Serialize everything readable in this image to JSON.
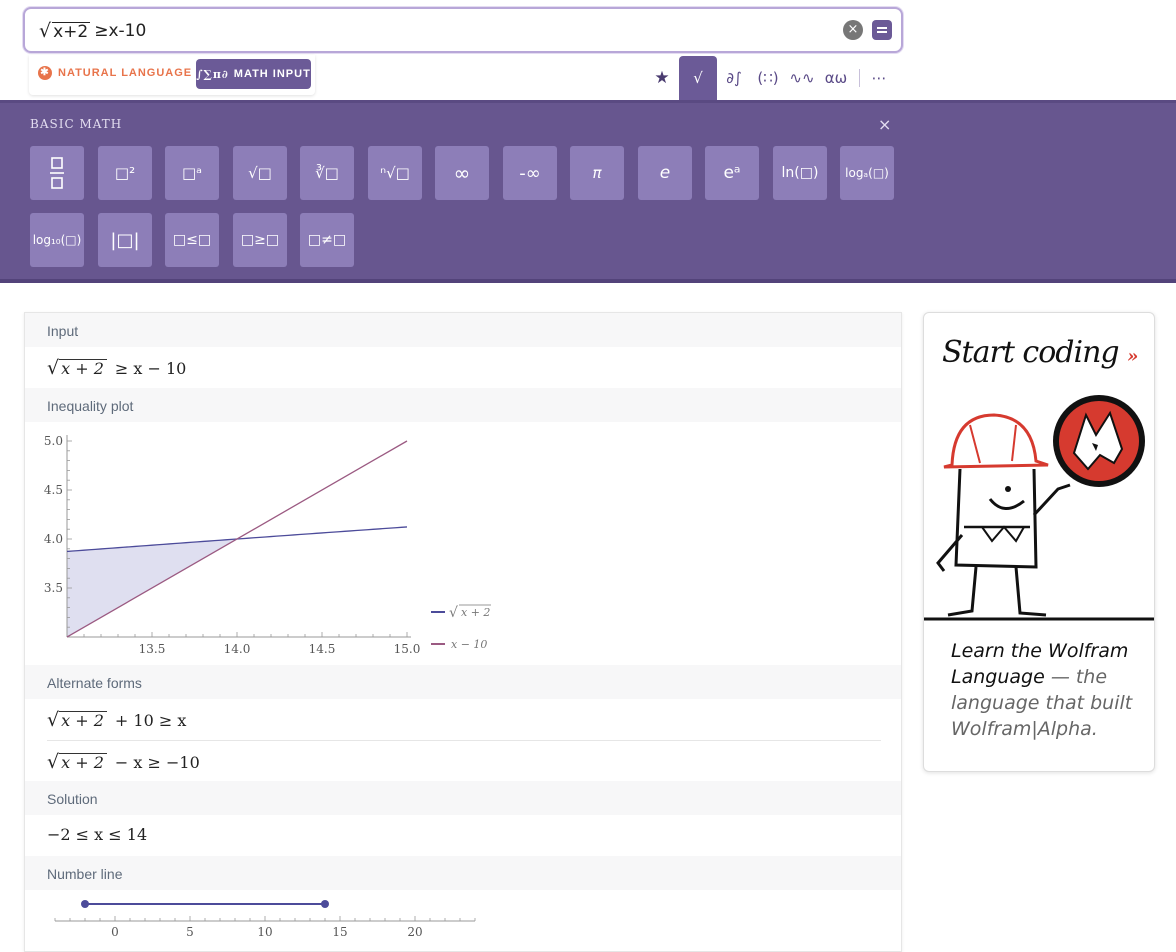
{
  "search": {
    "radicand": "x+2",
    "rest": "≥x-10",
    "clear_glyph": "×"
  },
  "modes": {
    "natural": "NATURAL LANGUAGE",
    "math": "MATH INPUT",
    "math_symbol": "∫∑π∂"
  },
  "tools": [
    "★",
    "√",
    "∂∫",
    "(∷)",
    "∿∿",
    "αω",
    "⋯"
  ],
  "panel": {
    "title": "BASIC MATH",
    "close": "×",
    "row1": [
      "fraction",
      "□²",
      "□ᵃ",
      "√□",
      "∛□",
      "ⁿ√□",
      "∞",
      "-∞",
      "π",
      "e",
      "eᵃ",
      "ln(□)",
      "logₐ(□)"
    ],
    "row2": [
      "log₁₀(□)",
      "|□|",
      "□≤□",
      "□≥□",
      "□≠□"
    ]
  },
  "pods": {
    "input": {
      "title": "Input",
      "radicand": "x + 2",
      "rest": "≥ x − 10"
    },
    "plot": {
      "title": "Inequality plot",
      "legend": [
        "x + 2",
        "x − 10"
      ]
    },
    "alternate": {
      "title": "Alternate forms",
      "form1_radicand": "x + 2",
      "form1_rest": "+ 10 ≥ x",
      "form2_radicand": "x + 2",
      "form2_rest": "− x ≥ −10"
    },
    "solution": {
      "title": "Solution",
      "value": "−2 ≤ x ≤ 14"
    },
    "numberline": {
      "title": "Number line",
      "ticks": [
        "0",
        "5",
        "10",
        "15",
        "20"
      ]
    }
  },
  "chart_data": {
    "type": "area",
    "x_ticks": [
      "13.5",
      "14.0",
      "14.5",
      "15.0"
    ],
    "y_ticks": [
      "3.5",
      "4.0",
      "4.5",
      "5.0"
    ],
    "xlim": [
      13,
      15
    ],
    "ylim": [
      3,
      5
    ],
    "series": [
      {
        "name": "x + 2",
        "function": "sqrt(x+2)",
        "color": "#4c4b9a"
      },
      {
        "name": "x − 10",
        "function": "x-10",
        "color": "#9b5a82"
      }
    ],
    "shaded_region": {
      "x_from": 13,
      "x_to": 14,
      "color": "#dcdcee"
    }
  },
  "numberline_data": {
    "interval": [
      -2,
      14
    ],
    "xlim": [
      -4,
      24
    ],
    "color": "#4c4b9a"
  },
  "ad": {
    "headline": "Start coding",
    "headline_chevron": "»",
    "line1": "Learn the Wolfram",
    "line2": "Language",
    "line2_light": " — the",
    "line3": "language that built",
    "line4": "Wolfram|Alpha."
  },
  "colors": {
    "accent": "#6b5a97",
    "panel": "#67568f",
    "key": "#8d7eb8",
    "orange": "#e8744b",
    "ad_red": "#d63a2f"
  }
}
